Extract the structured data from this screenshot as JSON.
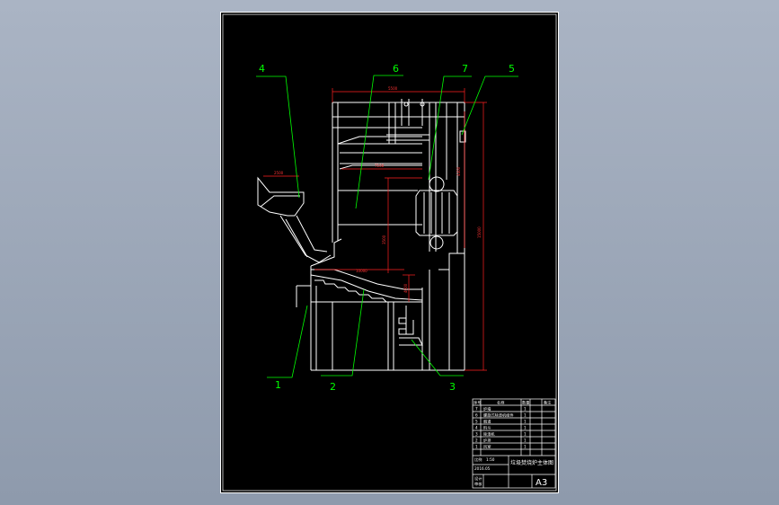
{
  "sheet": {
    "paper_size": "A3"
  },
  "callouts": [
    {
      "id": "1",
      "label": "1"
    },
    {
      "id": "2",
      "label": "2"
    },
    {
      "id": "3",
      "label": "3"
    },
    {
      "id": "4",
      "label": "4"
    },
    {
      "id": "5",
      "label": "5"
    },
    {
      "id": "6",
      "label": "6"
    },
    {
      "id": "7",
      "label": "7"
    }
  ],
  "dimensions": {
    "top_width": "5500",
    "hopper_width": "2500",
    "inner_width": "7100",
    "upper_height": "4400",
    "overall_height": "15000",
    "mid_height": "3500",
    "grate_length": "10000",
    "lower_height": "4000"
  },
  "title_block": {
    "header": [
      "序号",
      "名称",
      "数量",
      "备注"
    ],
    "parts": [
      {
        "no": "7",
        "name": "炉墙",
        "qty": "1"
      },
      {
        "no": "6",
        "name": "螺旋式除渣机组件",
        "qty": "1"
      },
      {
        "no": "5",
        "name": "烟道",
        "qty": "1"
      },
      {
        "no": "4",
        "name": "料斗",
        "qty": "1"
      },
      {
        "no": "3",
        "name": "除渣机",
        "qty": "1"
      },
      {
        "no": "2",
        "name": "炉排",
        "qty": "1"
      },
      {
        "no": "1",
        "name": "风室",
        "qty": "1"
      }
    ],
    "title": "垃圾焚烧炉主体图",
    "designer_label": "设计",
    "checker_label": "审核",
    "date": "2016.05",
    "scale_label": "比例",
    "scale": "1:50",
    "sheet_size": "A3"
  }
}
